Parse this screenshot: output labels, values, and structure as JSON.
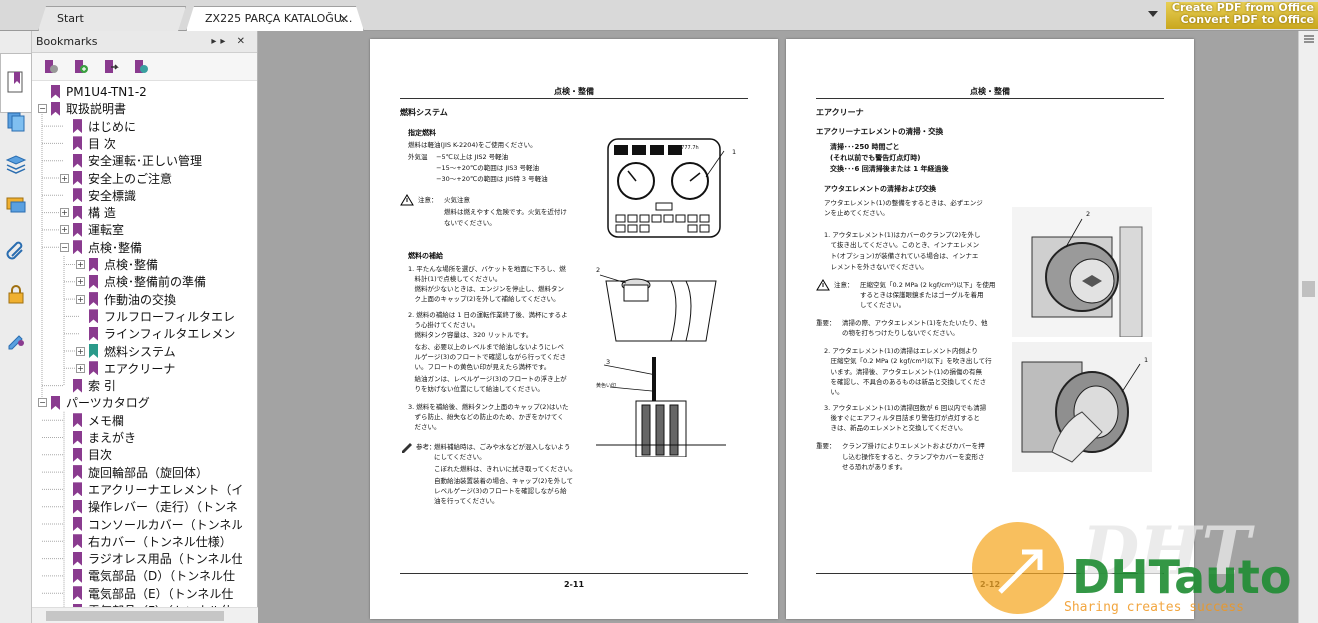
{
  "tabs": {
    "start_label": "Start",
    "doc_label": "ZX225 PARÇA KATALOĞU...",
    "close_glyph": "✕"
  },
  "promo": {
    "line1": "Create PDF from Office",
    "line2": "Convert PDF to Office"
  },
  "bookmarks": {
    "title": "Bookmarks",
    "header_controls": "▸▸ ✕",
    "items": [
      {
        "label": "PM1U4-TN1-2",
        "level": 0,
        "exp": "none"
      },
      {
        "label": "取扱説明書",
        "level": 0,
        "exp": "minus"
      },
      {
        "label": "はじめに",
        "level": 1,
        "exp": "none"
      },
      {
        "label": "目 次",
        "level": 1,
        "exp": "none"
      },
      {
        "label": "安全運転･正しい管理",
        "level": 1,
        "exp": "none"
      },
      {
        "label": "安全上のご注意",
        "level": 1,
        "exp": "plus"
      },
      {
        "label": "安全標識",
        "level": 1,
        "exp": "none"
      },
      {
        "label": "構 造",
        "level": 1,
        "exp": "plus"
      },
      {
        "label": "運転室",
        "level": 1,
        "exp": "plus"
      },
      {
        "label": "点検･整備",
        "level": 1,
        "exp": "minus"
      },
      {
        "label": "点検･整備",
        "level": 2,
        "exp": "plus"
      },
      {
        "label": "点検･整備前の準備",
        "level": 2,
        "exp": "plus"
      },
      {
        "label": "作動油の交換",
        "level": 2,
        "exp": "plus"
      },
      {
        "label": "フルフローフィルタエレ",
        "level": 2,
        "exp": "none"
      },
      {
        "label": "ラインフィルタエレメン",
        "level": 2,
        "exp": "none"
      },
      {
        "label": "燃料システム",
        "level": 2,
        "exp": "plus",
        "teal": true
      },
      {
        "label": "エアクリーナ",
        "level": 2,
        "exp": "plus"
      },
      {
        "label": "索 引",
        "level": 1,
        "exp": "none"
      },
      {
        "label": "パーツカタログ",
        "level": 0,
        "exp": "minus"
      },
      {
        "label": "メモ欄",
        "level": 1,
        "exp": "none"
      },
      {
        "label": "まえがき",
        "level": 1,
        "exp": "none"
      },
      {
        "label": "目次",
        "level": 1,
        "exp": "none"
      },
      {
        "label": "旋回輪部品（旋回体）",
        "level": 1,
        "exp": "none"
      },
      {
        "label": "エアクリーナエレメント（イ",
        "level": 1,
        "exp": "none"
      },
      {
        "label": "操作レバー（走行）（トンネ",
        "level": 1,
        "exp": "none"
      },
      {
        "label": "コンソールカバー（トンネル",
        "level": 1,
        "exp": "none"
      },
      {
        "label": "右カバー（トンネル仕様）",
        "level": 1,
        "exp": "none"
      },
      {
        "label": "ラジオレス用品（トンネル仕",
        "level": 1,
        "exp": "none"
      },
      {
        "label": "電気部品（D）（トンネル仕",
        "level": 1,
        "exp": "none"
      },
      {
        "label": "電気部品（E）（トンネル仕",
        "level": 1,
        "exp": "none"
      },
      {
        "label": "電気部品（F）（トンネル仕",
        "level": 1,
        "exp": "none"
      }
    ]
  },
  "page_left": {
    "header": "点検・整備",
    "section": "燃料システム",
    "sub1": "指定燃料",
    "para1": "燃料は軽油(JIS K-2204)をご使用ください。",
    "para2": "外気温　 −5℃以上は JIS2 号軽油",
    "para3": "　　　　 −15〜+20℃の範囲は JIS3 号軽油",
    "para4": "　　　　 −30〜+20℃の範囲は JIS特 3 号軽油",
    "caution_label": "注意：",
    "caution_text1": "火気注意",
    "caution_text2": "燃料は燃えやすく危険です。火気を近付け",
    "caution_text3": "ないでください。",
    "sub2": "燃料の補給",
    "step1a": "1. 平たんな場所を選び、バケットを地面に下ろし、燃",
    "step1b": "　料計(1)で点検してください。",
    "step1c": "　燃料が少ないときは、エンジンを停止し、燃料タン",
    "step1d": "　ク上面のキャップ(2)を外して補給してください。",
    "step2a": "2. 燃料の補給は 1 日の運転作業終了後、満杯にするよ",
    "step2b": "　う心掛けてください。",
    "step2c": "　燃料タンク容量は、320 リットルです。",
    "step2d": "　なお、必要以上のレベルまで給油しないようにレベ",
    "step2e": "　ルゲージ(3)のフロートで確認しながら行ってくださ",
    "step2f": "　い。フロートの黄色い印が見えたら満杯です。",
    "step2g": "　給油ガンは、レベルゲージ(3)のフロートの浮き上が",
    "step2h": "　りを妨げない位置にして給油してください。",
    "step3a": "3. 燃料を補給後、燃料タンク上面のキャップ(2)はいた",
    "step3b": "　ずら防止、紛失などの防止のため、かぎをかけてく",
    "step3c": "　ださい。",
    "ref_label": "参考：",
    "ref1": "燃料補給時は、ごみや水などが混入しないよう",
    "ref2": "にしてください。",
    "ref3": "こぼれた燃料は、きれいに拭き取ってください。",
    "ref4": "自動給油装置装着の場合、キャップ(2)を外して",
    "ref5": "レベルゲージ(3)のフロートを確認しながら給",
    "ref6": "油を行ってください。",
    "fig_label1": "1",
    "fig_label2": "2",
    "fig_label3": "3",
    "fig_label_yellow": "黄色い印",
    "gauge_readout": "7777.7h",
    "page_number": "2-11"
  },
  "page_right": {
    "header": "点検・整備",
    "section": "エアクリーナ",
    "sub1": "エアクリーナエレメントの清掃・交換",
    "sched1": "清掃･･･250 時間ごと",
    "sched2": "(それ以前でも警告灯点灯時)",
    "sched3": "交換･･･6 回清掃後または 1 年経過後",
    "sub2": "アウタエレメントの清掃および交換",
    "intro1": "アウタエレメント(1)の整備をするときは、必ずエンジ",
    "intro2": "ンを止めてください。",
    "step1a": "1. アウタエレメント(1)はカバーのクランプ(2)を外し",
    "step1b": "　て抜き出してください。このとき、インナエレメン",
    "step1c": "　ト(オプション)が装備されている場合は、インナエ",
    "step1d": "　レメントを外さないでください。",
    "caution_label": "注意：",
    "caution1": "圧縮空気「0.2 MPa (2 kgf/cm²)以下」を使用",
    "caution2": "するときは保護眼鏡またはゴーグルを着用",
    "caution3": "してください。",
    "important_label": "重要：",
    "imp1": "清掃の際、アウタエレメント(1)をたたいたり、他",
    "imp2": "の物を打ちつけたりしないでください。",
    "step2a": "2. アウタエレメント(1)の清掃はエレメント内側より",
    "step2b": "　圧縮空気「0.2 MPa (2 kgf/cm²)以下」を吹き出して行",
    "step2c": "　います。清掃後、アウタエレメント(1)の損傷の有無",
    "step2d": "　を確認し、不具合のあるものは新品と交換してくださ",
    "step2e": "　い。",
    "step3a": "3. アウタエレメント(1)の清掃回数が 6 回以内でも清掃",
    "step3b": "　後すぐにエアフィルタ目詰まり警告灯が点灯すると",
    "step3c": "　きは、新品のエレメントと交換してください。",
    "important2_label": "重要：",
    "imp2_1": "クランプ掛けによりエレメントおよびカバーを押",
    "imp2_2": "し込む操作をすると、クランプやカバーを変形さ",
    "imp2_3": "せる恐れがあります。",
    "fig_label1": "1",
    "fig_label2": "2",
    "page_number": "2-12"
  },
  "watermark": {
    "word1": "DHT",
    "word2": "DHTauto",
    "tagline": "Sharing creates success"
  },
  "colors": {
    "bookmark_purple": "#8a3b8f",
    "bookmark_teal": "#2a9a8a",
    "promo_gold": "#d8b93a"
  }
}
